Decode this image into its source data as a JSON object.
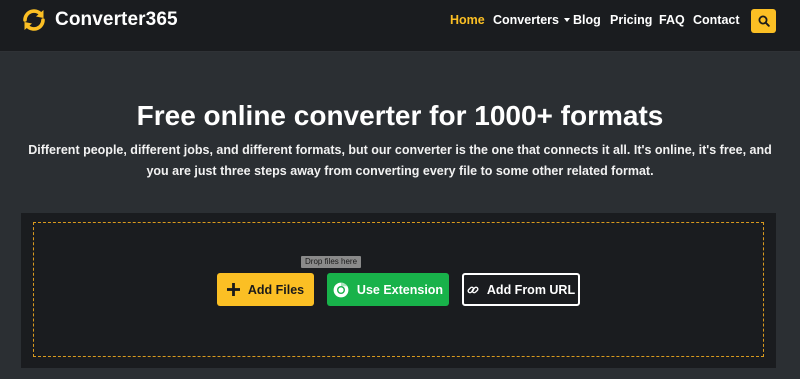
{
  "brand": {
    "name": "Converter365",
    "logo_icon": "refresh-arrows-icon",
    "accent": "#fbbf24"
  },
  "nav": {
    "items": [
      {
        "label": "Home",
        "active": true
      },
      {
        "label": "Converters",
        "has_dropdown": true
      },
      {
        "label": "Blog"
      },
      {
        "label": "Pricing"
      },
      {
        "label": "FAQ"
      },
      {
        "label": "Contact"
      }
    ],
    "search_icon": "search-icon"
  },
  "hero": {
    "title": "Free online converter for 1000+ formats",
    "subtitle": "Different people, different jobs, and different formats, but our converter is the one that connects it all. It's online, it's free, and you are just three steps away from converting every file to some other related format."
  },
  "upload": {
    "drop_hint": "Drop files here",
    "buttons": [
      {
        "label": "Add Files",
        "icon": "plus-icon",
        "color": "#fbbf24"
      },
      {
        "label": "Use Extension",
        "icon": "chrome-icon",
        "color": "#18b24a"
      },
      {
        "label": "Add From URL",
        "icon": "link-icon"
      }
    ]
  }
}
